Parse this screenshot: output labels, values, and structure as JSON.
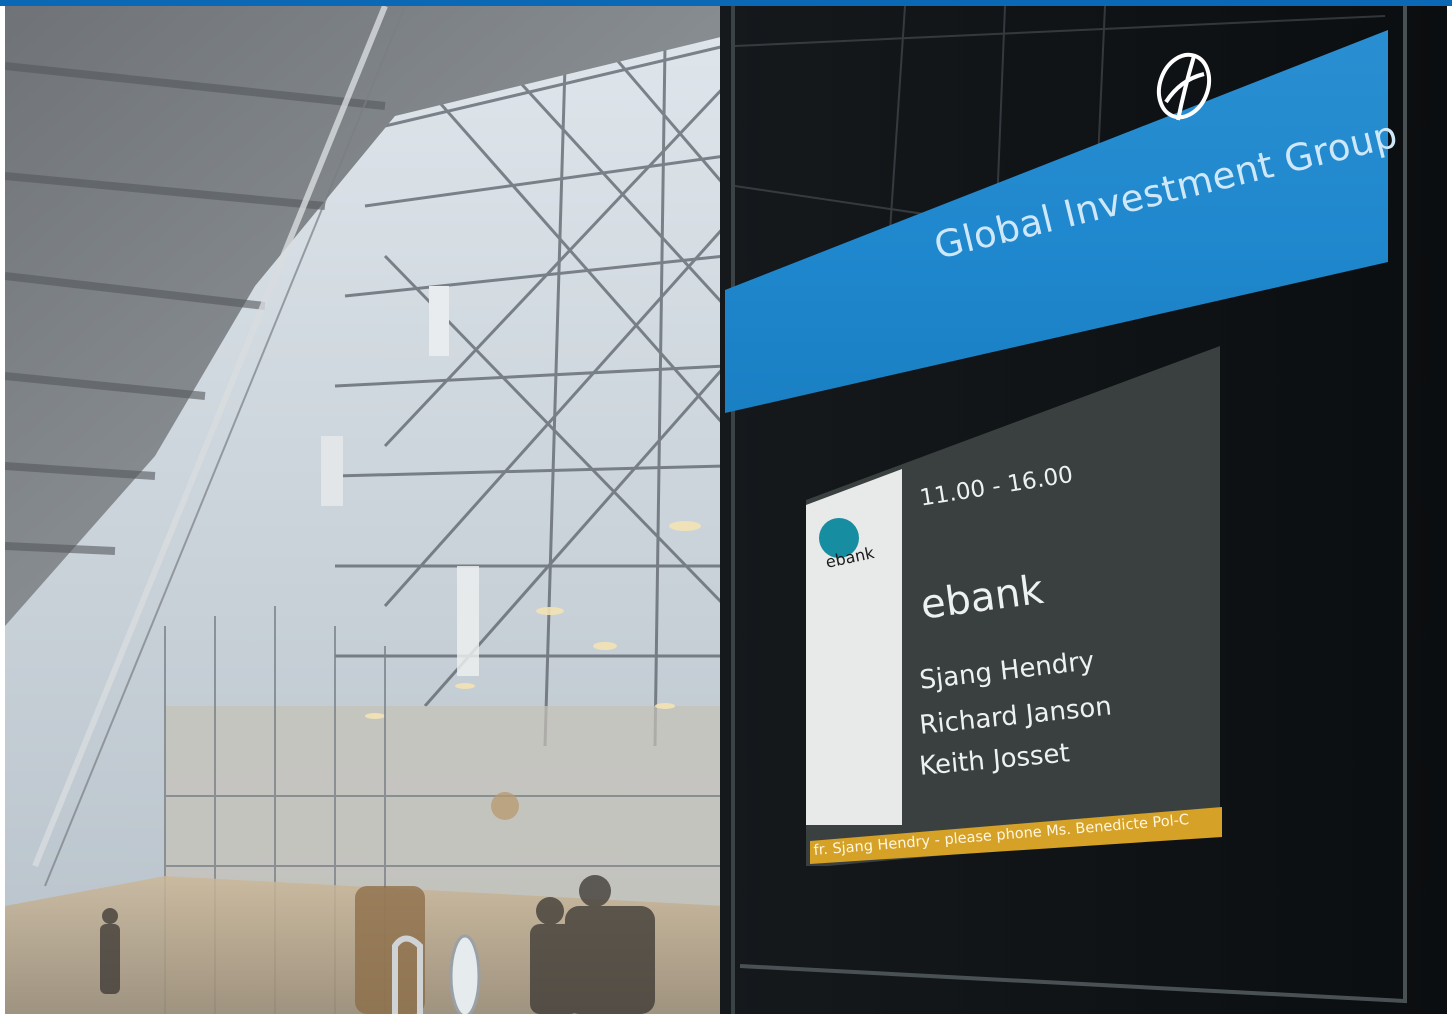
{
  "sign": {
    "company_name": "Global Investment Group",
    "logo_icon": "globe-icon"
  },
  "meeting": {
    "time": "11.00 - 16.00",
    "company": "ebank",
    "logo_text": "ebank",
    "attendees": [
      "Sjang Hendry",
      "Richard Janson",
      "Keith Josset"
    ],
    "ticker_message": "fr. Sjang Hendry - please phone Ms. Benedicte Pol-C"
  },
  "colors": {
    "frame_blue": "#0a68b4",
    "sign_blue": "#1f87cd",
    "screen_dark": "#3a403f",
    "ticker_gold": "#d5a127",
    "ebank_teal": "#168da0"
  }
}
